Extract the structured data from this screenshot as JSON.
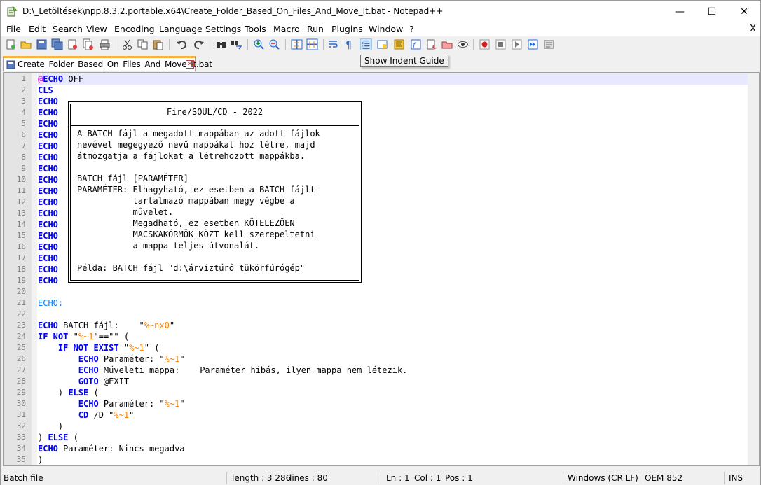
{
  "window": {
    "title": "D:\\_Letöltések\\npp.8.3.2.portable.x64\\Create_Folder_Based_On_Files_And_Move_It.bat - Notepad++",
    "min_glyph": "—",
    "max_glyph": "☐",
    "close_glyph": "✕"
  },
  "menu": {
    "items": [
      "File",
      "Edit",
      "Search",
      "View",
      "Encoding",
      "Language",
      "Settings",
      "Tools",
      "Macro",
      "Run",
      "Plugins",
      "Window",
      "?"
    ],
    "close_glyph": "X"
  },
  "toolbar": {
    "tooltip": "Show Indent Guide",
    "icons": [
      "new-icon",
      "open-icon",
      "save-icon",
      "save-all-icon",
      "close-icon",
      "close-all-icon",
      "print-icon",
      "cut-icon",
      "copy-icon",
      "paste-icon",
      "undo-icon",
      "redo-icon",
      "find-icon",
      "replace-icon",
      "zoom-in-icon",
      "zoom-out-icon",
      "sync-vertical-icon",
      "sync-horizontal-icon",
      "word-wrap-icon",
      "show-all-chars-icon",
      "indent-guide-icon",
      "user-language-icon",
      "document-map-icon",
      "function-list-icon",
      "folder-as-workspace-icon",
      "monitoring-icon",
      "record-macro-icon",
      "stop-record-icon",
      "play-macro-icon",
      "run-macro-multiple-icon",
      "save-macro-icon"
    ]
  },
  "tab": {
    "label": "Create_Folder_Based_On_Files_And_Move_It.bat",
    "close_glyph": "✕"
  },
  "editor": {
    "lines": [
      {
        "n": "1",
        "tokens": [
          [
            "at",
            "@"
          ],
          [
            "kw",
            "ECHO"
          ],
          [
            "sym",
            " OFF"
          ]
        ]
      },
      {
        "n": "2",
        "tokens": [
          [
            "kw",
            "CLS"
          ]
        ]
      },
      {
        "n": "3",
        "tokens": [
          [
            "kw",
            "ECHO"
          ]
        ]
      },
      {
        "n": "4",
        "tokens": [
          [
            "kw",
            "ECHO"
          ]
        ]
      },
      {
        "n": "5",
        "tokens": [
          [
            "kw",
            "ECHO"
          ]
        ]
      },
      {
        "n": "6",
        "tokens": [
          [
            "kw",
            "ECHO"
          ]
        ]
      },
      {
        "n": "7",
        "tokens": [
          [
            "kw",
            "ECHO"
          ]
        ]
      },
      {
        "n": "8",
        "tokens": [
          [
            "kw",
            "ECHO"
          ]
        ]
      },
      {
        "n": "9",
        "tokens": [
          [
            "kw",
            "ECHO"
          ]
        ]
      },
      {
        "n": "10",
        "tokens": [
          [
            "kw",
            "ECHO"
          ]
        ]
      },
      {
        "n": "11",
        "tokens": [
          [
            "kw",
            "ECHO"
          ]
        ]
      },
      {
        "n": "12",
        "tokens": [
          [
            "kw",
            "ECHO"
          ]
        ]
      },
      {
        "n": "13",
        "tokens": [
          [
            "kw",
            "ECHO"
          ]
        ]
      },
      {
        "n": "14",
        "tokens": [
          [
            "kw",
            "ECHO"
          ]
        ]
      },
      {
        "n": "15",
        "tokens": [
          [
            "kw",
            "ECHO"
          ]
        ]
      },
      {
        "n": "16",
        "tokens": [
          [
            "kw",
            "ECHO"
          ]
        ]
      },
      {
        "n": "17",
        "tokens": [
          [
            "kw",
            "ECHO"
          ]
        ]
      },
      {
        "n": "18",
        "tokens": [
          [
            "kw",
            "ECHO"
          ]
        ]
      },
      {
        "n": "19",
        "tokens": [
          [
            "kw",
            "ECHO"
          ]
        ]
      },
      {
        "n": "20",
        "tokens": []
      },
      {
        "n": "21",
        "tokens": [
          [
            "lbl",
            "ECHO:"
          ]
        ]
      },
      {
        "n": "22",
        "tokens": []
      },
      {
        "n": "23",
        "tokens": [
          [
            "kw",
            "ECHO"
          ],
          [
            "sym",
            " BATCH fájl:    \""
          ],
          [
            "var",
            "%~nx0"
          ],
          [
            "sym",
            "\""
          ]
        ]
      },
      {
        "n": "24",
        "tokens": [
          [
            "kw",
            "IF NOT"
          ],
          [
            "sym",
            " \""
          ],
          [
            "var",
            "%~1"
          ],
          [
            "sym",
            "\"==\"\" ("
          ]
        ]
      },
      {
        "n": "25",
        "tokens": [
          [
            "sym",
            "    "
          ],
          [
            "kw",
            "IF NOT EXIST"
          ],
          [
            "sym",
            " \""
          ],
          [
            "var",
            "%~1"
          ],
          [
            "sym",
            "\" ("
          ]
        ]
      },
      {
        "n": "26",
        "tokens": [
          [
            "sym",
            "        "
          ],
          [
            "kw",
            "ECHO"
          ],
          [
            "sym",
            " Paraméter: \""
          ],
          [
            "var",
            "%~1"
          ],
          [
            "sym",
            "\""
          ]
        ]
      },
      {
        "n": "27",
        "tokens": [
          [
            "sym",
            "        "
          ],
          [
            "kw",
            "ECHO"
          ],
          [
            "sym",
            " Műveleti mappa:    Paraméter hibás, ilyen mappa nem létezik."
          ]
        ]
      },
      {
        "n": "28",
        "tokens": [
          [
            "sym",
            "        "
          ],
          [
            "kw",
            "GOTO"
          ],
          [
            "sym",
            " @EXIT"
          ]
        ]
      },
      {
        "n": "29",
        "tokens": [
          [
            "sym",
            "    ) "
          ],
          [
            "kw",
            "ELSE"
          ],
          [
            "sym",
            " ("
          ]
        ]
      },
      {
        "n": "30",
        "tokens": [
          [
            "sym",
            "        "
          ],
          [
            "kw",
            "ECHO"
          ],
          [
            "sym",
            " Paraméter: \""
          ],
          [
            "var",
            "%~1"
          ],
          [
            "sym",
            "\""
          ]
        ]
      },
      {
        "n": "31",
        "tokens": [
          [
            "sym",
            "        "
          ],
          [
            "kw",
            "CD"
          ],
          [
            "sym",
            " /D \""
          ],
          [
            "var",
            "%~1"
          ],
          [
            "sym",
            "\""
          ]
        ]
      },
      {
        "n": "32",
        "tokens": [
          [
            "sym",
            "    )"
          ]
        ]
      },
      {
        "n": "33",
        "tokens": [
          [
            "sym",
            ") "
          ],
          [
            "kw",
            "ELSE"
          ],
          [
            "sym",
            " ("
          ]
        ]
      },
      {
        "n": "34",
        "tokens": [
          [
            "kw",
            "ECHO"
          ],
          [
            "sym",
            " Paraméter: Nincs megadva"
          ]
        ]
      },
      {
        "n": "35",
        "tokens": [
          [
            "sym",
            ")"
          ]
        ]
      }
    ],
    "box": {
      "title": "Fire/SOUL/CD - 2022",
      "body": "A BATCH fájl a megadott mappában az adott fájlok\nnevével megegyező nevű mappákat hoz létre, majd\nátmozgatja a fájlokat a létrehozott mappákba.\n\nBATCH fájl [PARAMÉTER]\nPARAMÉTER: Elhagyható, ez esetben a BATCH fájlt\n           tartalmazó mappában megy végbe a\n           művelet.\n           Megadható, ez esetben KÖTELEZŐEN\n           MACSKAKÖRMÖK KÖZT kell szerepeltetni\n           a mappa teljes útvonalát.\n\nPélda: BATCH fájl \"d:\\árvíztűrő tükörfúrógép\""
    }
  },
  "status": {
    "filetype": "Batch file",
    "length": "length : 3 286",
    "lines": "lines : 80",
    "ln": "Ln : 1",
    "col": "Col : 1",
    "pos": "Pos : 1",
    "eol": "Windows (CR LF)",
    "encoding": "OEM 852",
    "mode": "INS"
  }
}
